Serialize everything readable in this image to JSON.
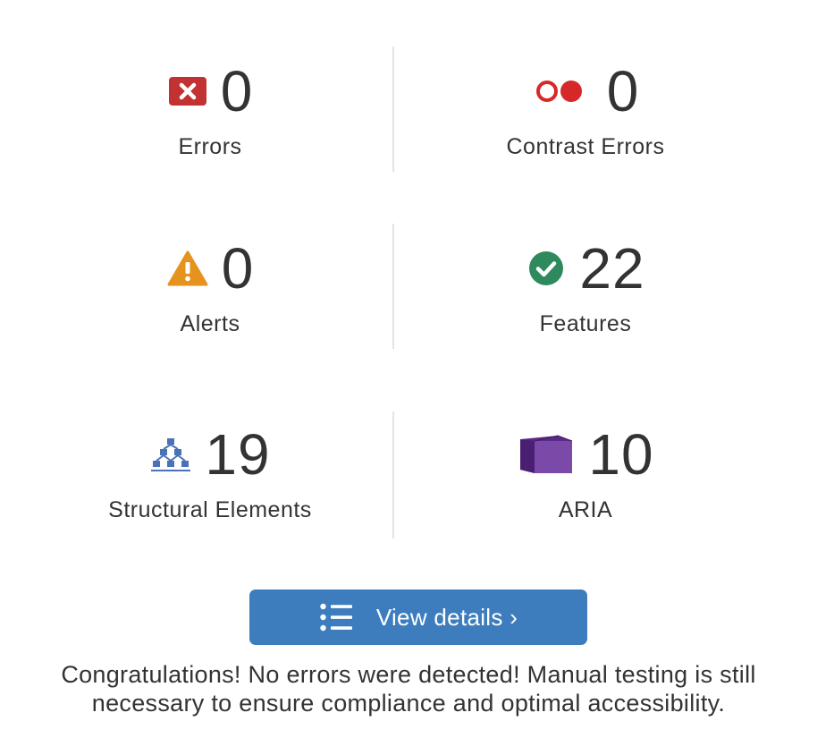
{
  "summary": {
    "errors": {
      "count": "0",
      "label": "Errors",
      "icon": "error-x-icon",
      "color": "#c33232"
    },
    "contrast_errors": {
      "count": "0",
      "label": "Contrast Errors",
      "icon": "contrast-icon",
      "color": "#d62828"
    },
    "alerts": {
      "count": "0",
      "label": "Alerts",
      "icon": "alert-triangle-icon",
      "color": "#e6921e"
    },
    "features": {
      "count": "22",
      "label": "Features",
      "icon": "check-circle-icon",
      "color": "#2e8a5d"
    },
    "structural": {
      "count": "19",
      "label": "Structural Elements",
      "icon": "structure-icon",
      "color": "#4a72b8"
    },
    "aria": {
      "count": "10",
      "label": "ARIA",
      "icon": "aria-cube-icon",
      "color": "#5b2a86"
    }
  },
  "view_details": {
    "label": "View details ›",
    "icon": "list-icon",
    "color": "#3d7dbe"
  },
  "message": "Congratulations! No errors were detected! Manual testing is still necessary to ensure compliance and optimal accessibility."
}
